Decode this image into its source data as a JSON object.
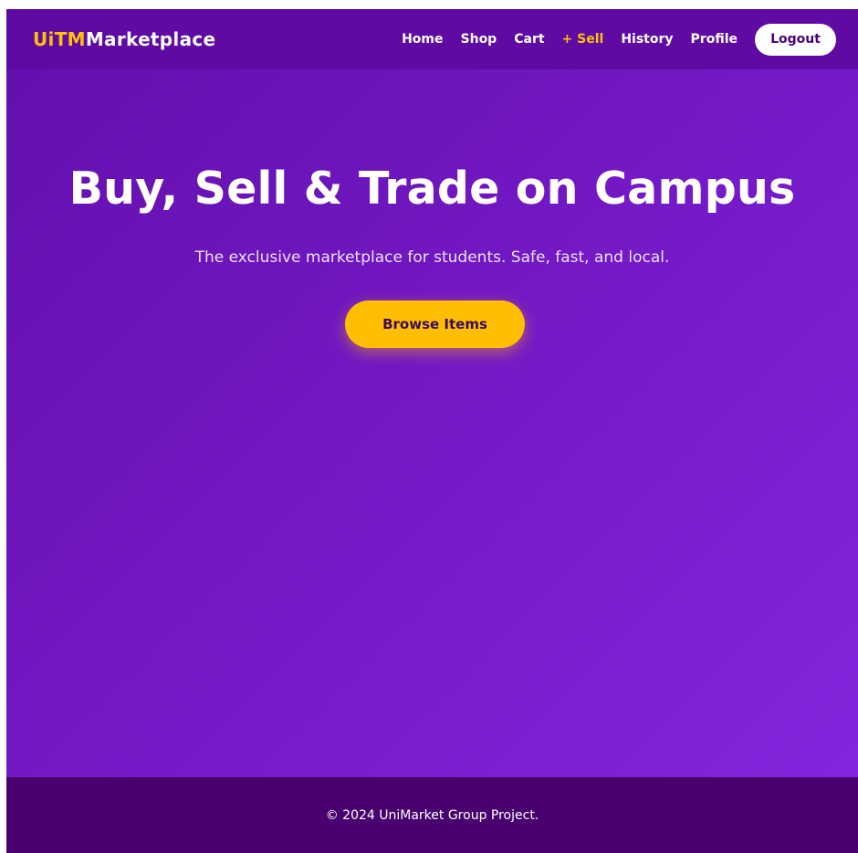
{
  "navbar": {
    "brand": {
      "accent": "UiTM",
      "main": "Marketplace"
    },
    "links": {
      "home": "Home",
      "shop": "Shop",
      "cart": "Cart",
      "sell": "+ Sell",
      "history": "History",
      "profile": "Profile"
    },
    "logout_label": "Logout"
  },
  "hero": {
    "title": "Buy, Sell & Trade on Campus",
    "subtitle": "The exclusive marketplace for students. Safe, fast, and local.",
    "cta_label": "Browse Items"
  },
  "footer": {
    "text": "© 2024 UniMarket Group Project."
  },
  "colors": {
    "navbar_bg": "#5e0aa3",
    "accent_yellow": "#ffc107",
    "hero_gradient_start": "#6310ae",
    "hero_gradient_end": "#8225dd",
    "footer_bg": "#48006e",
    "button_text": "#3b0a5e"
  }
}
